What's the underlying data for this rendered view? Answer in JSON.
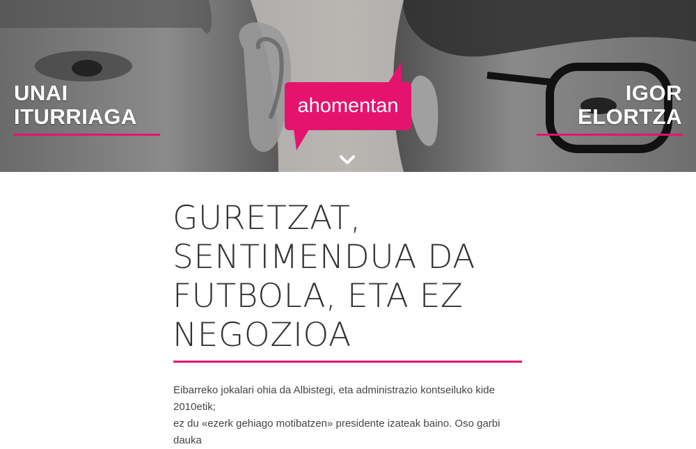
{
  "hero": {
    "left_person": {
      "first": "UNAI",
      "last": "ITURRIAGA"
    },
    "right_person": {
      "first": "IGOR",
      "last": "ELORTZA"
    },
    "bubble_label": "ahomentan",
    "scroll_icon": "chevron-down-icon",
    "accent_color": "#e6136e"
  },
  "article": {
    "title": "GURETZAT, SENTIMENDUA DA FUTBOLA, ETA EZ NEGOZIOA",
    "intro_lines": [
      "Eibarreko jokalari ohia da Albistegi, eta administrazio kontseiluko kide 2010etik;",
      "ez du «ezerk gehiago motibatzen» presidente izateak baino. Oso garbi dauka"
    ]
  }
}
